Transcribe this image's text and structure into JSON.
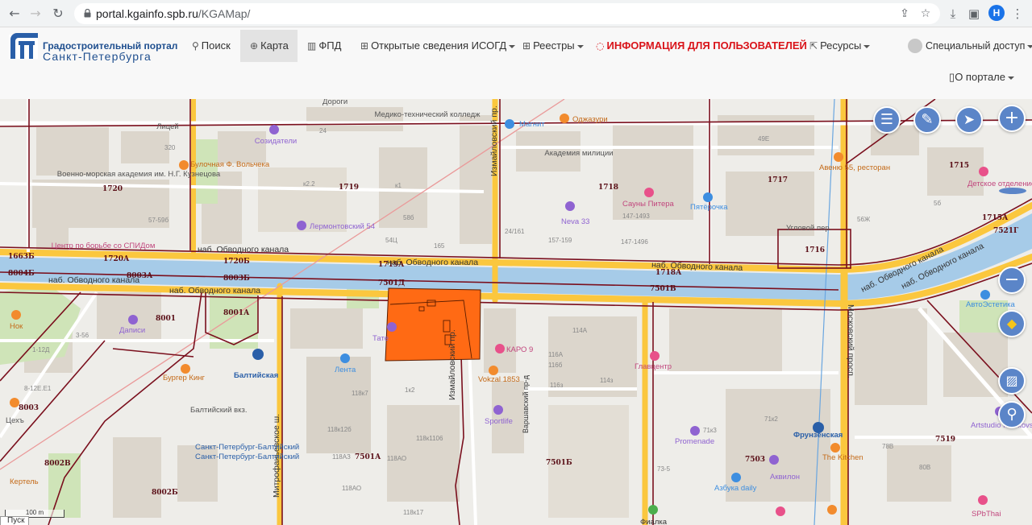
{
  "browser": {
    "url_host": "portal.kgainfo.spb.ru",
    "url_path": "/KGAMap/",
    "profile_initial": "H"
  },
  "portal": {
    "brand_line1": "Градостроительный портал",
    "brand_line2": "Санкт-Петербурга",
    "menu": {
      "search": "Поиск",
      "map": "Карта",
      "fpd": "ФПД",
      "isogd": "Открытые сведения ИСОГД",
      "registries": "Реестры",
      "info": "ИНФОРМАЦИЯ ДЛЯ ПОЛЬЗОВАТЕЛЕЙ",
      "resources": "Ресурсы",
      "special": "Специальный доступ"
    },
    "about": "О портале"
  },
  "map": {
    "blocks": [
      "1720",
      "1719",
      "1718",
      "1717",
      "1715",
      "1715А",
      "1663Б",
      "1720А",
      "1720Б",
      "1719А",
      "1718А",
      "1716",
      "8004Б",
      "8003А",
      "8003Б",
      "7501Д",
      "7501В",
      "8001А",
      "8001",
      "8003",
      "8002В",
      "8002Б",
      "7501А",
      "7501Б",
      "7503",
      "7519",
      "7521Г"
    ],
    "streets": [
      "наб. Обводного канала",
      "Измайловский пр.",
      "Московский просп.",
      "Митрофаньевское ш.",
      "Варшавский пр-д"
    ],
    "places": [
      "Медико-технический колледж",
      "Магнит",
      "Оджазури",
      "Академия милиции",
      "Созидатели",
      "Лицей",
      "Военно-морская академия им. Н.Г. Кузнецова",
      "Булочная Ф. Вольчека",
      "Лермонтовский 54",
      "Neva 33",
      "Сауны Питера",
      "Пятёрочка",
      "Авеню 55, ресторан",
      "Детское отделение",
      "Центр по борьбе со СПИДом",
      "Угловой пер.",
      "Дороги",
      "Нок",
      "Даписи",
      "Балтийская",
      "Бургер Кинг",
      "Лента",
      "Тате",
      "КАРО 9",
      "Vokzal 1853",
      "Главцентр",
      "Балтийский вкз.",
      "Санкт-Петербург-Балтийский",
      "Sportlife",
      "Promenade",
      "Фрунзенская",
      "The Kitchen",
      "АвтоЭстетика",
      "Artstudio Moskovsky",
      "Азбука daily",
      "Аквилон",
      "Цехъ",
      "SPbThai",
      "Фиалка",
      "Кертель"
    ],
    "scale_label": "100 m",
    "pusk_label": "Пуск",
    "colors": {
      "highlight": "#ff6a14",
      "canal": "#a6cbe8",
      "major_road": "#fbc73e",
      "road": "#ffffff",
      "block_border": "#7a0f1d",
      "control": "#5b85c8"
    }
  }
}
